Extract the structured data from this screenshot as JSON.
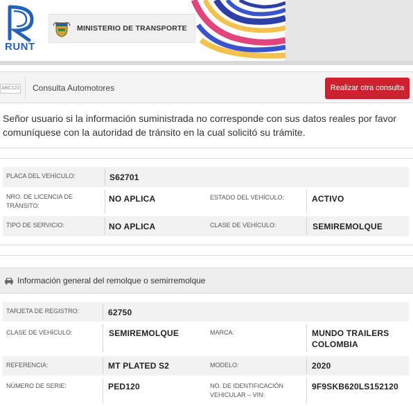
{
  "header": {
    "brand": "RUNT",
    "ministry": "MINISTERIO DE TRANSPORTE"
  },
  "colors": {
    "accent_red": "#cf2030",
    "runt_blue": "#2462b5"
  },
  "toolbar": {
    "icon_label": "ABC123",
    "title": "Consulta Automotores",
    "new_query_button": "Realizar otra consulta"
  },
  "notice": "Señor usuario si la información suministrada no corresponde con sus datos reales por favor comuníquese con la autoridad de tránsito en la cual solicitó su trámite.",
  "vehicle": {
    "placa_label": "PLACA DEL VEHÍCULO:",
    "placa_value": "S62701",
    "licencia_label": "NRO. DE LICENCIA DE TRÁNSITO:",
    "licencia_value": "NO APLICA",
    "estado_label": "ESTADO DEL VEHÍCULO:",
    "estado_value": "ACTIVO",
    "servicio_label": "TIPO DE SERVICIO:",
    "servicio_value": "NO APLICA",
    "clase_label": "CLASE DE VEHÍCULO:",
    "clase_value": "SEMIREMOLQUE"
  },
  "section2": {
    "title": "Información general del remolque o semirremolque",
    "tarjeta_label": "TARJETA DE REGISTRO:",
    "tarjeta_value": "62750",
    "clase_label": "CLASE DE VEHÍCULO:",
    "clase_value": "SEMIREMOLQUE",
    "marca_label": "MARCA:",
    "marca_value": "MUNDO TRAILERS COLOMBIA",
    "referencia_label": "REFERENCIA:",
    "referencia_value": "MT PLATED S2",
    "modelo_label": "MODELO:",
    "modelo_value": "2020",
    "serie_label": "NÚMERO DE SERIE:",
    "serie_value": "PED120",
    "vin_label": "NO. DE IDENTIFICACIÓN VEHICULAR – VIN:",
    "vin_value": "9F9SKB620LS152120"
  }
}
